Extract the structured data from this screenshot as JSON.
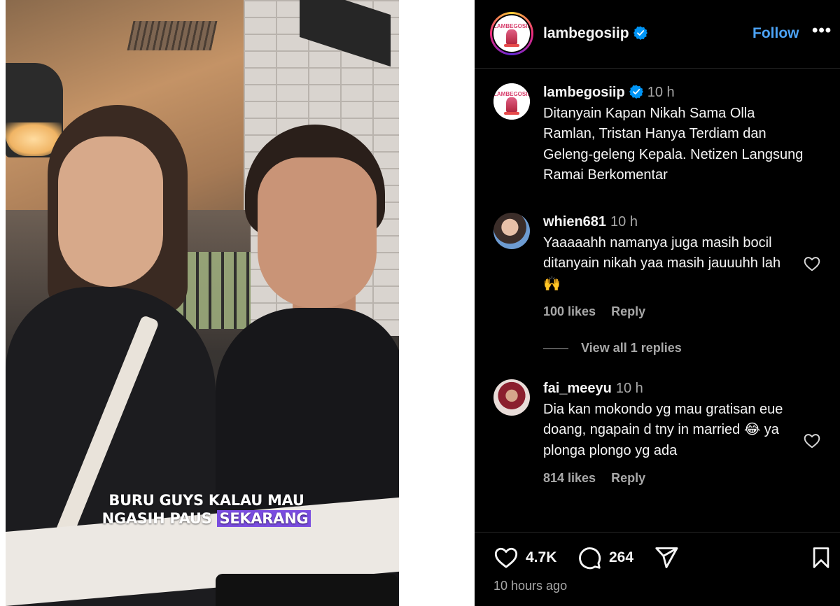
{
  "video": {
    "caption_line1": "BURU GUYS KALAU MAU",
    "caption_line2_a": "NGASIH PAUS ",
    "caption_line2_b": "SEKARANG"
  },
  "header": {
    "username": "lambegosiip",
    "verified": true,
    "follow_label": "Follow",
    "more_icon": "more-horizontal-icon",
    "avatar_logo_text": "LAMBEGOSIIP"
  },
  "caption_post": {
    "username": "lambegosiip",
    "time": "10 h",
    "text": "Ditanyain Kapan Nikah Sama Olla Ramlan, Tristan Hanya Terdiam dan Geleng-geleng Kepala. Netizen Langsung Ramai Berkomentar"
  },
  "comments": [
    {
      "username": "whien681",
      "time": "10 h",
      "text": "Yaaaaahh namanya juga masih bocil ditanyain nikah yaa masih jauuuhh lah 🙌",
      "likes": "100 likes",
      "reply": "Reply"
    },
    {
      "username": "fai_meeyu",
      "time": "10 h",
      "text": "Dia kan mokondo yg mau gratisan eue doang, ngapain d tny in married 😂 ya plonga plongo yg ada",
      "likes": "814 likes",
      "reply": "Reply"
    }
  ],
  "view_replies": "View all 1 replies",
  "actions": {
    "like_count": "4.7K",
    "comment_count": "264",
    "posted_ago": "10 hours ago"
  },
  "colors": {
    "accent_blue": "#4ca3f6",
    "muted_text": "#a8a8a8",
    "caption_highlight": "#7a4de0"
  }
}
